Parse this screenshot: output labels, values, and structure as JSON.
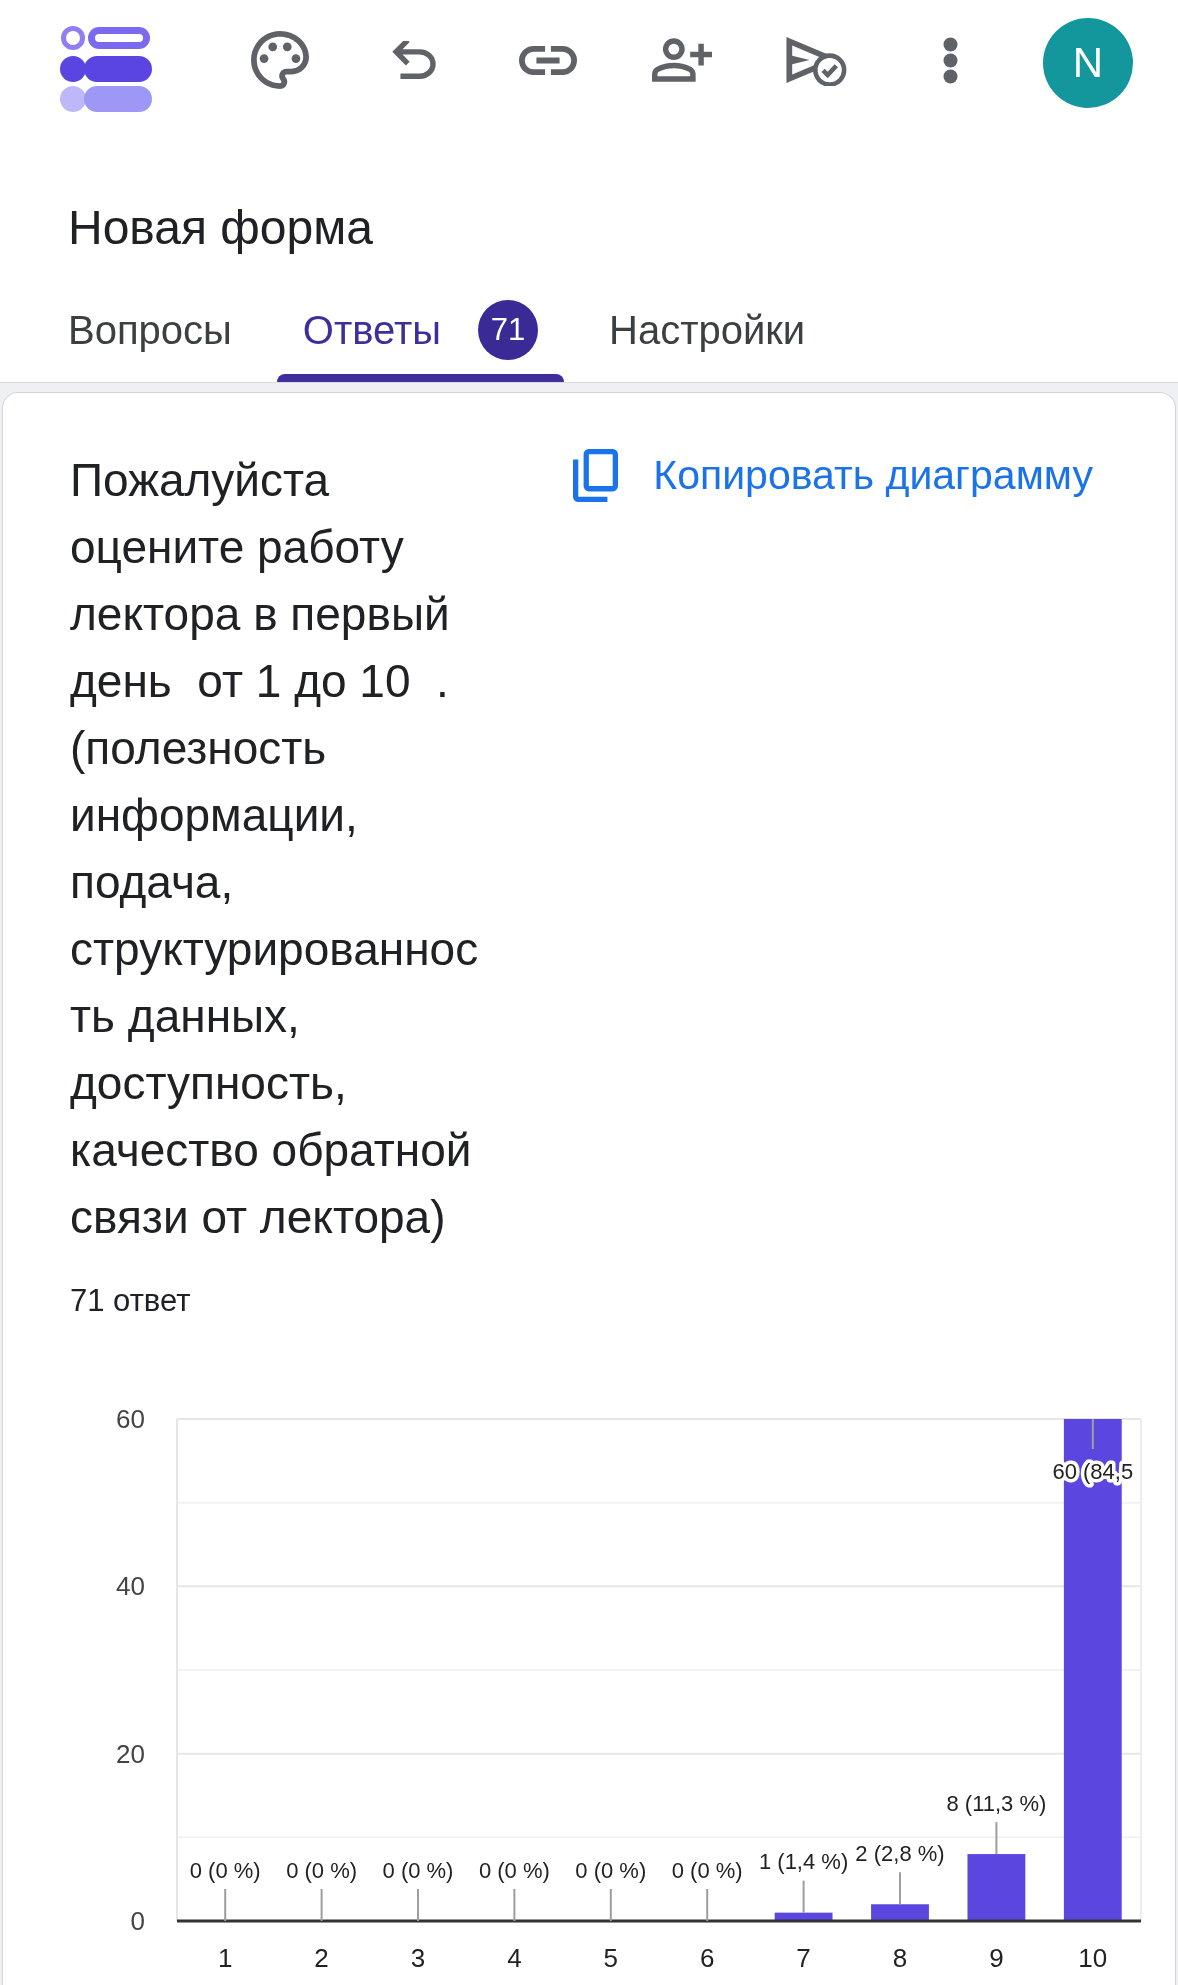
{
  "account": {
    "avatar_letter": "N"
  },
  "form": {
    "title": "Новая форма"
  },
  "tabs": [
    {
      "label": "Вопросы",
      "selected": false
    },
    {
      "label": "Ответы",
      "selected": true,
      "badge": "71"
    },
    {
      "label": "Настройки",
      "selected": false
    }
  ],
  "summary": {
    "question": "Пожалуйста оцените работу лектора в первый день  от 1 до 10  . (полезность информации, подача, структурированность данных, доступность, качество обратной связи от лектора)",
    "copy_button": "Копировать диаграмму",
    "response_count": "71 ответ",
    "chart_data": {
      "type": "bar",
      "categories": [
        "1",
        "2",
        "3",
        "4",
        "5",
        "6",
        "7",
        "8",
        "9",
        "10"
      ],
      "values": [
        0,
        0,
        0,
        0,
        0,
        0,
        1,
        2,
        8,
        60
      ],
      "ylim": [
        0,
        60
      ],
      "yticks": [
        0,
        20,
        40,
        60
      ],
      "value_labels": [
        "0 (0 %)",
        "0 (0 %)",
        "0 (0 %)",
        "0 (0 %)",
        "0 (0 %)",
        "0 (0 %)",
        "1 (1,4 %)",
        "2 (2,8 %)",
        "8 (11,3 %)",
        "60 (84,5"
      ]
    }
  }
}
